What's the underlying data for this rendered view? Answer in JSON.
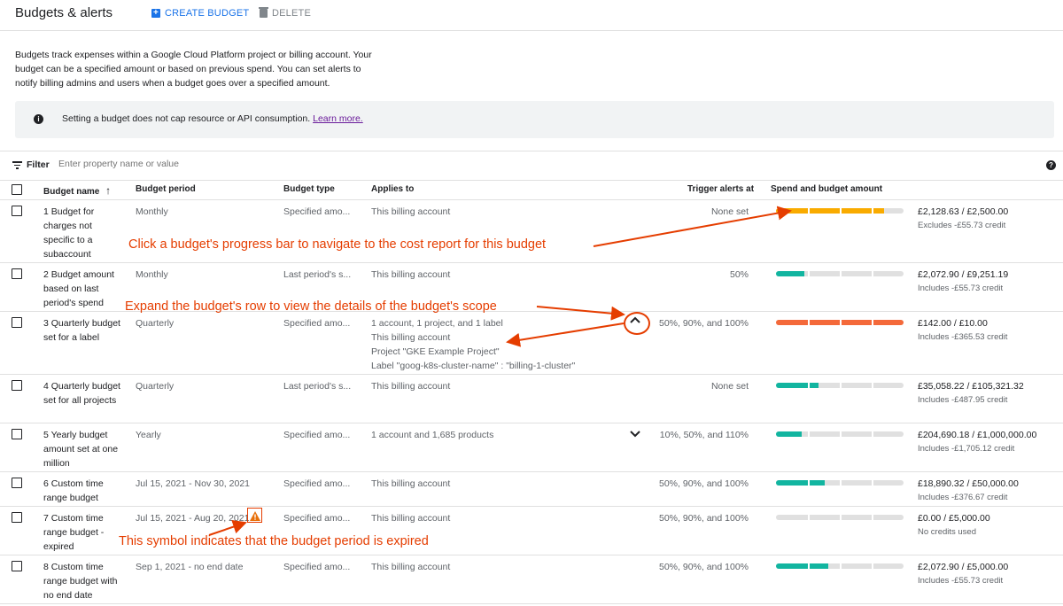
{
  "header": {
    "title": "Budgets & alerts",
    "create_label": "CREATE BUDGET",
    "delete_label": "DELETE"
  },
  "intro_text": "Budgets track expenses within a Google Cloud Platform project or billing account. Your budget can be a specified amount or based on previous spend. You can set alerts to notify billing admins and users when a budget goes over a specified amount.",
  "info": {
    "text": "Setting a budget does not cap resource or API consumption.",
    "link": "Learn more."
  },
  "filter": {
    "label": "Filter",
    "placeholder": "Enter property name or value"
  },
  "columns": {
    "name": "Budget name",
    "period": "Budget period",
    "type": "Budget type",
    "applies": "Applies to",
    "trigger": "Trigger alerts at",
    "spend": "Spend and budget amount"
  },
  "rows": [
    {
      "name": "1 Budget for charges not specific to a subaccount",
      "period": "Monthly",
      "type": "Specified amo...",
      "applies": [
        "This billing account"
      ],
      "trigger": "None set",
      "amount": "£2,128.63 / £2,500.00",
      "credit": "Excludes -£55.73 credit",
      "progress": 0.85,
      "color": "#f9ab00"
    },
    {
      "name": "2 Budget amount based on last period's spend",
      "period": "Monthly",
      "type": "Last period's s...",
      "applies": [
        "This billing account"
      ],
      "trigger": "50%",
      "amount": "£2,072.90 / £9,251.19",
      "credit": "Includes -£55.73 credit",
      "progress": 0.22,
      "color": "#12b5a0"
    },
    {
      "name": "3 Quarterly budget set for a label",
      "period": "Quarterly",
      "type": "Specified amo...",
      "applies": [
        "1 account, 1 project, and 1 label",
        "This billing account",
        "Project \"GKE Example Project\"",
        "Label \"goog-k8s-cluster-name\" : \"billing-1-cluster\""
      ],
      "trigger": "50%, 90%, and 100%",
      "amount": "£142.00 / £10.00",
      "credit": "Includes -£365.53 credit",
      "progress": 1.0,
      "color": "#f4693a"
    },
    {
      "name": "4 Quarterly budget set for all projects",
      "period": "Quarterly",
      "type": "Last period's s...",
      "applies": [
        "This billing account"
      ],
      "trigger": "None set",
      "amount": "£35,058.22 / £105,321.32",
      "credit": "Includes -£487.95 credit",
      "progress": 0.33,
      "color": "#12b5a0"
    },
    {
      "name": "5 Yearly budget amount set at one million",
      "period": "Yearly",
      "type": "Specified amo...",
      "applies": [
        "1 account and 1,685 products"
      ],
      "trigger": "10%, 50%, and 110%",
      "amount": "£204,690.18 / £1,000,000.00",
      "credit": "Includes -£1,705.12 credit",
      "progress": 0.2,
      "color": "#12b5a0"
    },
    {
      "name": "6 Custom time range budget",
      "period": "Jul 15, 2021 - Nov 30, 2021",
      "type": "Specified amo...",
      "applies": [
        "This billing account"
      ],
      "trigger": "50%, 90%, and 100%",
      "amount": "£18,890.32 / £50,000.00",
      "credit": "Includes -£376.67 credit",
      "progress": 0.38,
      "color": "#12b5a0"
    },
    {
      "name": "7 Custom time range budget - expired",
      "period": "Jul 15, 2021 - Aug 20, 2021",
      "type": "Specified amo...",
      "applies": [
        "This billing account"
      ],
      "trigger": "50%, 90%, and 100%",
      "amount": "£0.00 / £5,000.00",
      "credit": "No credits used",
      "progress": 0.0,
      "color": "#12b5a0"
    },
    {
      "name": "8 Custom time range budget with no end date",
      "period": "Sep 1, 2021 - no end date",
      "type": "Specified amo...",
      "applies": [
        "This billing account"
      ],
      "trigger": "50%, 90%, and 100%",
      "amount": "£2,072.90 / £5,000.00",
      "credit": "Includes -£55.73 credit",
      "progress": 0.41,
      "color": "#12b5a0"
    }
  ],
  "annotations": {
    "progress": "Click a budget's progress bar to navigate to the cost report for this budget",
    "expand": "Expand the budget's row to view the details of the budget's scope",
    "expired": "This symbol indicates that the budget period is expired"
  },
  "warning_icon": "warning-triangle-icon",
  "accent_color": "#1a73e8",
  "annotation_color": "#e53d00"
}
